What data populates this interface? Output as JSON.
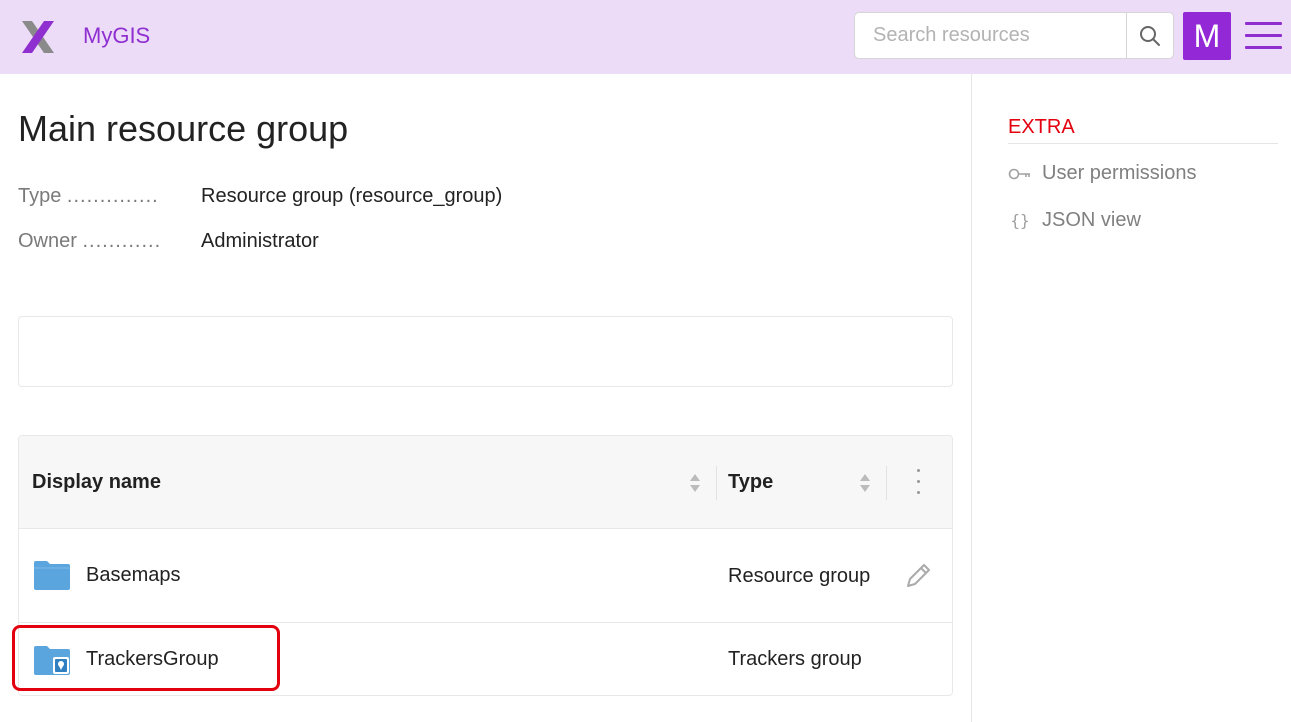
{
  "header": {
    "brand": "MyGIS",
    "search_placeholder": "Search resources",
    "avatar_letter": "M"
  },
  "page": {
    "title": "Main resource group",
    "meta": [
      {
        "label": "Type",
        "dots": "..............",
        "value": "Resource group (resource_group)"
      },
      {
        "label": "Owner",
        "dots": "............",
        "value": "Administrator"
      }
    ]
  },
  "table": {
    "columns": [
      "Display name",
      "Type"
    ],
    "rows": [
      {
        "name": "Basemaps",
        "type": "Resource group",
        "icon": "folder-icon"
      },
      {
        "name": "TrackersGroup",
        "type": "Trackers group",
        "icon": "trackers-folder-icon"
      }
    ]
  },
  "sidebar": {
    "title": "EXTRA",
    "links": [
      {
        "label": "User permissions",
        "icon": "key-icon"
      },
      {
        "label": "JSON view",
        "icon": "braces-icon"
      }
    ]
  },
  "colors": {
    "header_bg": "#ecdcf8",
    "brand": "#8f2fd0",
    "avatar_bg": "#9228d6",
    "extra_red": "#e3000f",
    "folder_blue": "#5aa5de"
  }
}
